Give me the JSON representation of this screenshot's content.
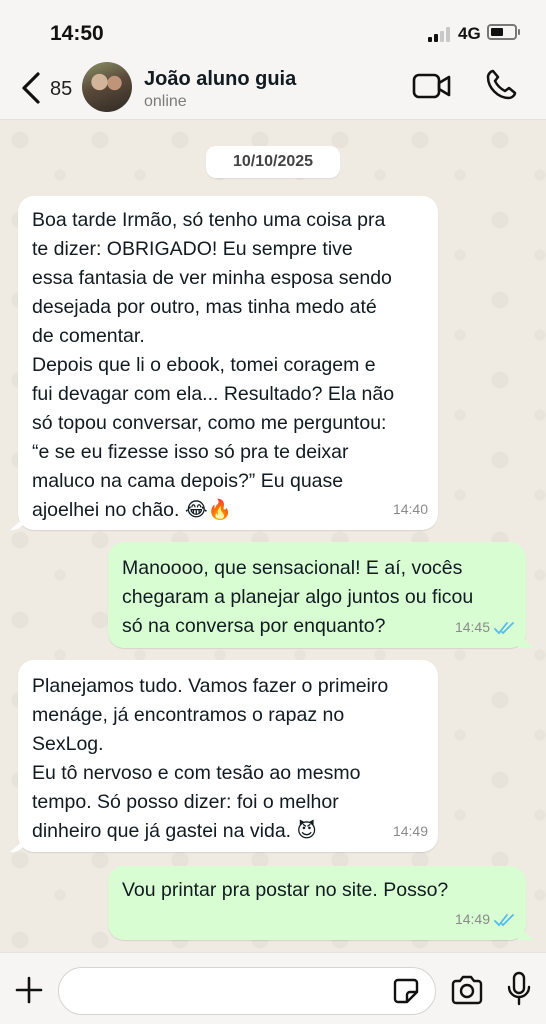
{
  "status_bar": {
    "time": "14:50",
    "network": "4G"
  },
  "header": {
    "unread_count": "85",
    "contact_name": "João aluno guia",
    "contact_status": "online"
  },
  "chat": {
    "date_chip": "10/10/2025",
    "messages": [
      {
        "direction": "incoming",
        "text": "Boa tarde Irmão, só tenho uma coisa pra\nte dizer: OBRIGADO! Eu sempre tive\nessa fantasia de ver minha esposa sendo\ndesejada por outro, mas tinha medo até\nde comentar.\nDepois que li o ebook, tomei coragem e\nfui devagar com ela... Resultado? Ela não\nsó topou conversar, como me perguntou:\n“e se eu fizesse isso só pra te deixar\nmaluco na cama depois?” Eu quase\najoelhei no chão. 😂🔥",
        "time": "14:40"
      },
      {
        "direction": "outgoing",
        "text": "Manoooo, que sensacional! E aí, vocês\nchegaram a planejar algo juntos ou ficou\nsó na conversa por enquanto?",
        "time": "14:45",
        "status": "read"
      },
      {
        "direction": "incoming",
        "text": "Planejamos tudo. Vamos fazer o primeiro\nmenáge, já encontramos o rapaz no\nSexLog.\nEu tô nervoso e com tesão ao mesmo\ntempo. Só posso dizer: foi o melhor\ndinheiro que já gastei na vida. 😈",
        "time": "14:49"
      },
      {
        "direction": "outgoing",
        "text": "Vou printar pra postar no site. Posso?",
        "time": "14:49",
        "status": "read"
      }
    ]
  },
  "input": {
    "value": "",
    "placeholder": ""
  },
  "colors": {
    "outgoing_bubble": "#d9fdd3",
    "incoming_bubble": "#ffffff",
    "read_ticks": "#53bdeb",
    "chat_background": "#efeae2"
  },
  "icons": {
    "back": "chevron-left-icon",
    "video": "video-camera-icon",
    "call": "phone-icon",
    "plus": "plus-icon",
    "sticker": "sticker-icon",
    "camera": "camera-icon",
    "mic": "microphone-icon"
  }
}
